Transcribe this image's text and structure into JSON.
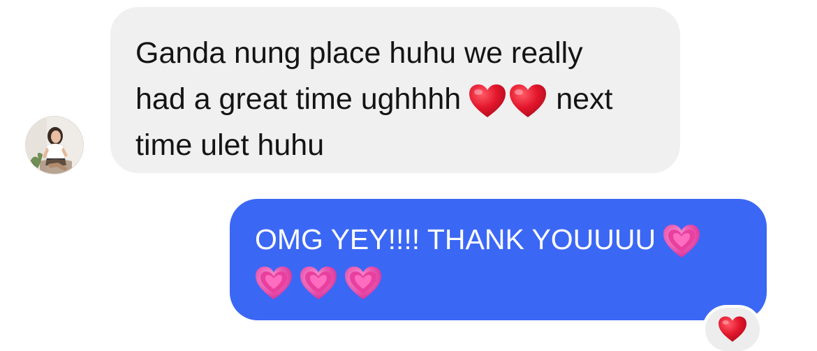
{
  "received": {
    "line1": "Ganda nung place huhu we really",
    "line2_before": "had a great time ughhhh",
    "line2_after": "next",
    "line3": "time ulet huhu",
    "emojis": [
      "red-heart-icon",
      "red-heart-icon"
    ]
  },
  "sent": {
    "line1": "OMG YEY!!!! THANK YOUUUU",
    "emojis": [
      "growing-heart-icon",
      "growing-heart-icon",
      "growing-heart-icon",
      "growing-heart-icon"
    ]
  },
  "reaction": {
    "emoji": "red-heart-icon"
  },
  "colors": {
    "received_bubble": "#f0f0f0",
    "sent_bubble": "#3b67f5",
    "received_text": "#141414",
    "sent_text": "#ffffff",
    "heart_red": "#e4142c",
    "heart_pink": "#e0399e"
  }
}
